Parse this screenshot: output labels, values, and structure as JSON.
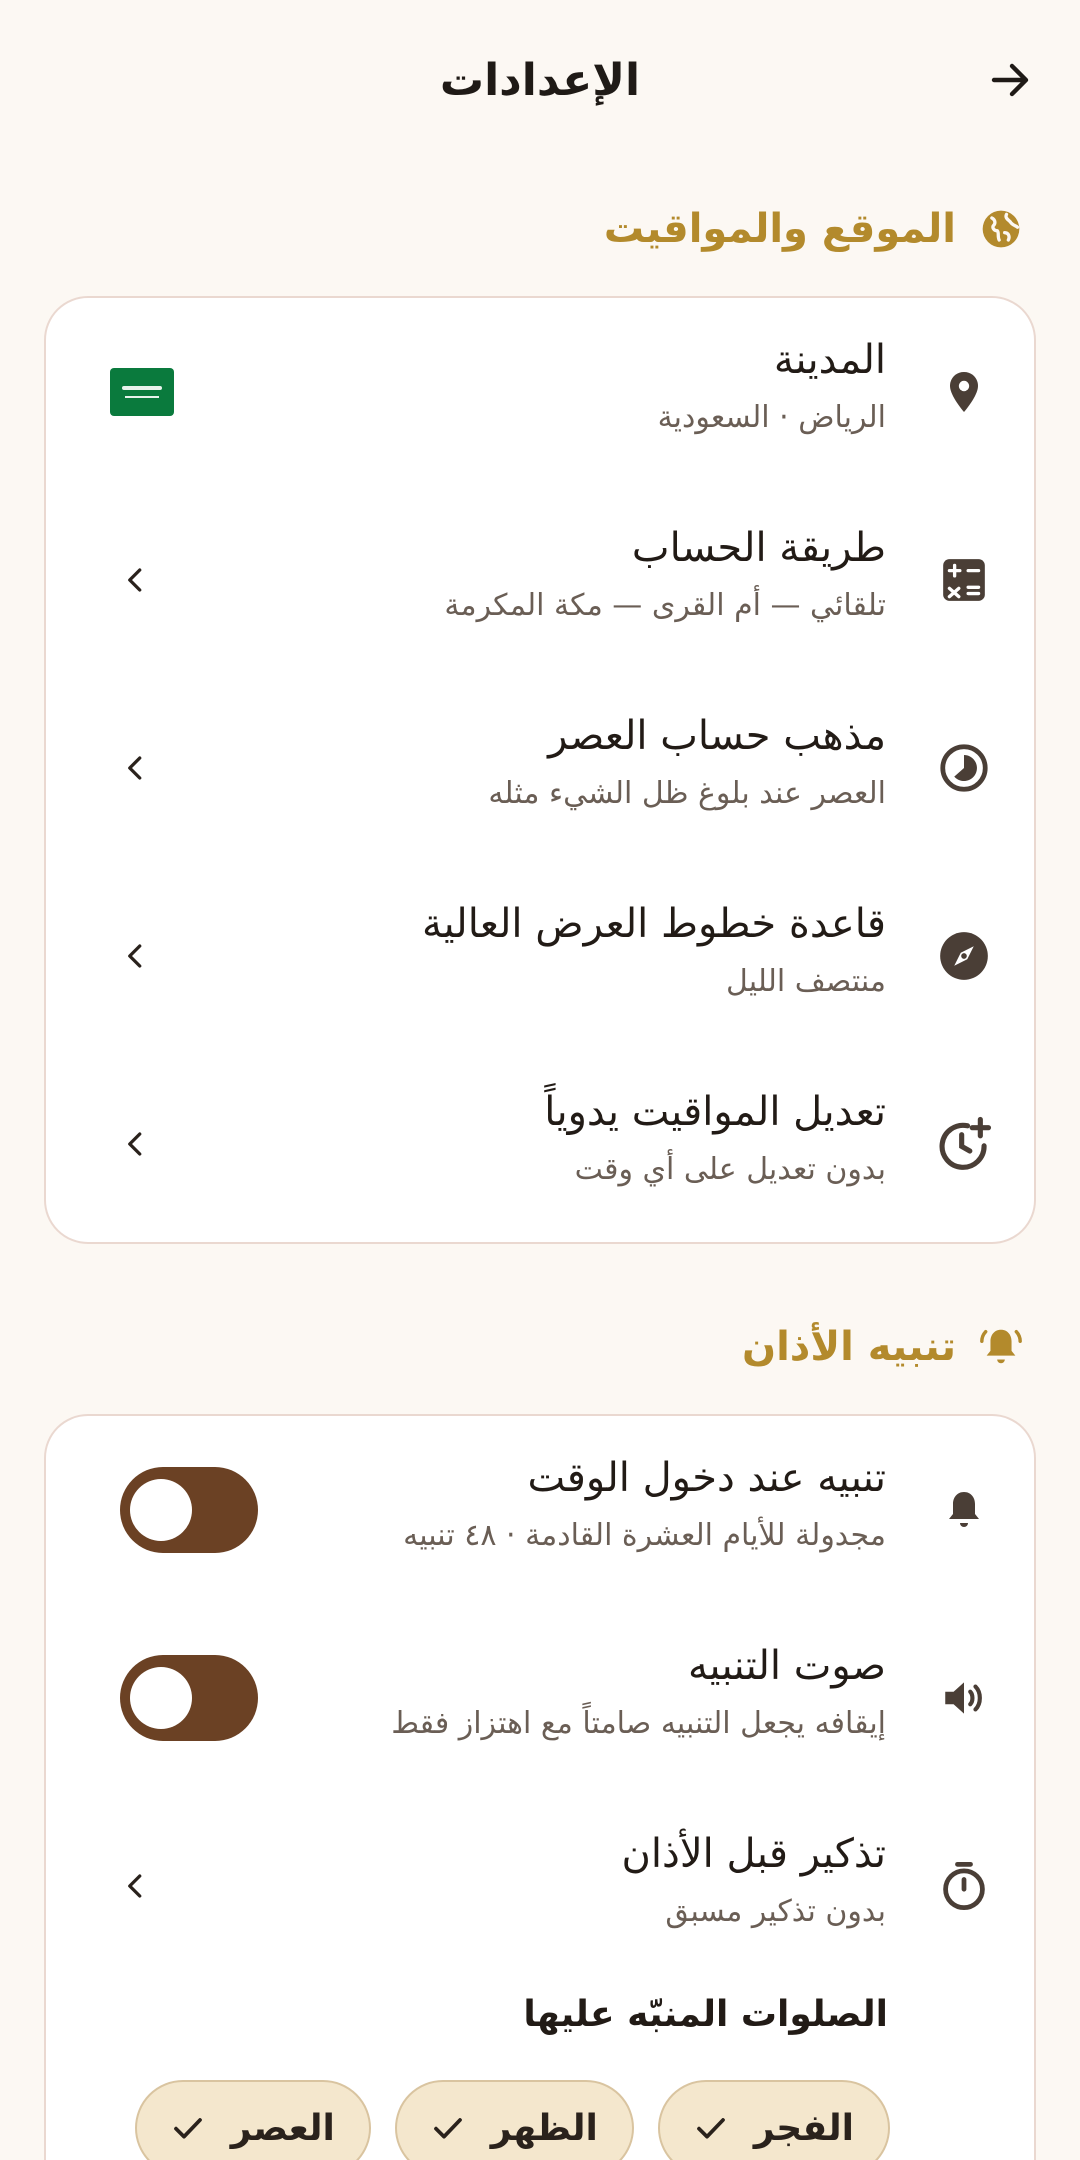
{
  "header": {
    "title": "الإعدادات"
  },
  "location_section": {
    "title": "الموقع والمواقيت",
    "rows": [
      {
        "title": "المدينة",
        "subtitle": "الرياض · السعودية"
      },
      {
        "title": "طريقة الحساب",
        "subtitle": "تلقائي — أم القرى — مكة المكرمة"
      },
      {
        "title": "مذهب حساب العصر",
        "subtitle": "العصر عند بلوغ ظل الشيء مثله"
      },
      {
        "title": "قاعدة خطوط العرض العالية",
        "subtitle": "منتصف الليل"
      },
      {
        "title": "تعديل المواقيت يدوياً",
        "subtitle": "بدون تعديل على أي وقت"
      }
    ]
  },
  "adhan_section": {
    "title": "تنبيه الأذان",
    "rows": [
      {
        "title": "تنبيه عند دخول الوقت",
        "subtitle": "مجدولة للأيام العشرة القادمة · ٤٨ تنبيه",
        "toggle_on": true
      },
      {
        "title": "صوت التنبيه",
        "subtitle": "إيقافه يجعل التنبيه صامتاً مع اهتزاز فقط",
        "toggle_on": true
      },
      {
        "title": "تذكير قبل الأذان",
        "subtitle": "بدون تذكير مسبق"
      }
    ],
    "prayers_heading": "الصلوات المنبّه عليها",
    "prayer_chips": [
      "الفجر",
      "الظهر",
      "العصر"
    ]
  },
  "colors": {
    "accent": "#b38a2c",
    "toggle": "#6b4124",
    "chip": "#f4e7cd",
    "background": "#fcf8f3"
  },
  "icons": [
    "arrow-right-icon",
    "globe-icon",
    "location-pin-icon",
    "calculator-icon",
    "clock-half-icon",
    "compass-icon",
    "clock-plus-icon",
    "bell-ring-icon",
    "bell-icon",
    "speaker-icon",
    "timer-icon",
    "chevron-left-icon",
    "check-icon"
  ]
}
